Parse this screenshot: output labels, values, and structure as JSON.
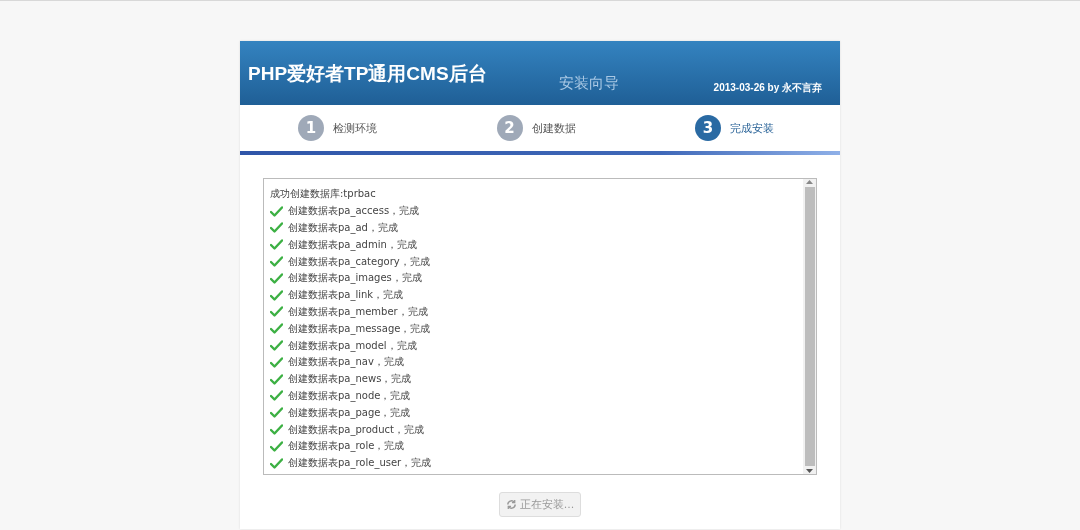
{
  "header": {
    "title": "PHP爱好者TP通用CMS后台",
    "subtitle": "安装向导",
    "credit": "2013-03-26 by 永不言弃"
  },
  "steps": [
    {
      "number": "1",
      "label": "检测环境",
      "selected": false
    },
    {
      "number": "2",
      "label": "创建数据",
      "selected": false
    },
    {
      "number": "3",
      "label": "完成安装",
      "selected": true
    }
  ],
  "log": [
    {
      "kind": "info",
      "text": "成功创建数据库:tprbac"
    },
    {
      "kind": "success",
      "text": "创建数据表pa_access，完成"
    },
    {
      "kind": "success",
      "text": "创建数据表pa_ad，完成"
    },
    {
      "kind": "success",
      "text": "创建数据表pa_admin，完成"
    },
    {
      "kind": "success",
      "text": "创建数据表pa_category，完成"
    },
    {
      "kind": "success",
      "text": "创建数据表pa_images，完成"
    },
    {
      "kind": "success",
      "text": "创建数据表pa_link，完成"
    },
    {
      "kind": "success",
      "text": "创建数据表pa_member，完成"
    },
    {
      "kind": "success",
      "text": "创建数据表pa_message，完成"
    },
    {
      "kind": "success",
      "text": "创建数据表pa_model，完成"
    },
    {
      "kind": "success",
      "text": "创建数据表pa_nav，完成"
    },
    {
      "kind": "success",
      "text": "创建数据表pa_news，完成"
    },
    {
      "kind": "success",
      "text": "创建数据表pa_node，完成"
    },
    {
      "kind": "success",
      "text": "创建数据表pa_page，完成"
    },
    {
      "kind": "success",
      "text": "创建数据表pa_product，完成"
    },
    {
      "kind": "success",
      "text": "创建数据表pa_role，完成"
    },
    {
      "kind": "success",
      "text": "创建数据表pa_role_user，完成"
    }
  ],
  "install_button": {
    "label": "正在安装...",
    "disabled": true
  }
}
